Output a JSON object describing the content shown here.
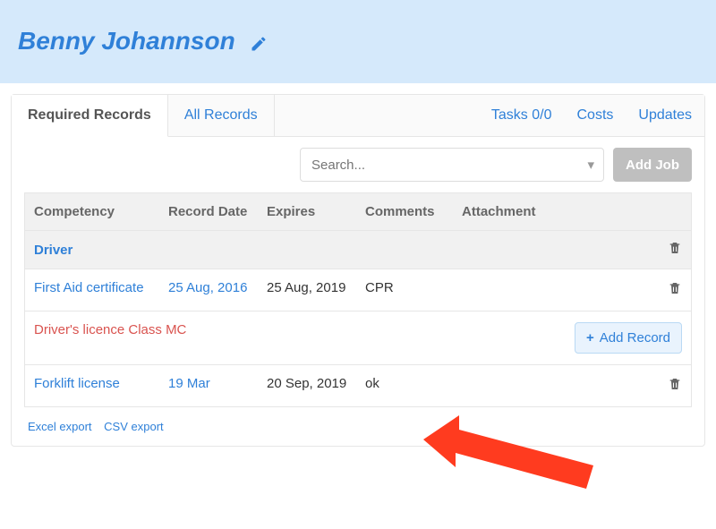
{
  "header": {
    "title": "Benny Johannson"
  },
  "tabs": {
    "required": "Required Records",
    "all": "All Records",
    "tasks": "Tasks 0/0",
    "costs": "Costs",
    "updates": "Updates"
  },
  "search": {
    "placeholder": "Search..."
  },
  "buttons": {
    "add_job": "Add Job",
    "add_record": "Add Record",
    "excel_export": "Excel export",
    "csv_export": "CSV export"
  },
  "columns": {
    "competency": "Competency",
    "record_date": "Record Date",
    "expires": "Expires",
    "comments": "Comments",
    "attachment": "Attachment"
  },
  "rows": [
    {
      "type": "group",
      "competency": "Driver",
      "style": "blue"
    },
    {
      "type": "data",
      "competency": "First Aid certificate",
      "record_date": "25 Aug, 2016",
      "expires": "25 Aug, 2019",
      "comments": "CPR",
      "style": "blue"
    },
    {
      "type": "missing",
      "competency": "Driver's licence Class MC",
      "style": "red"
    },
    {
      "type": "data",
      "competency": "Forklift license",
      "record_date": "19 Mar",
      "expires": "20 Sep, 2019",
      "comments": "ok",
      "style": "blue"
    }
  ]
}
